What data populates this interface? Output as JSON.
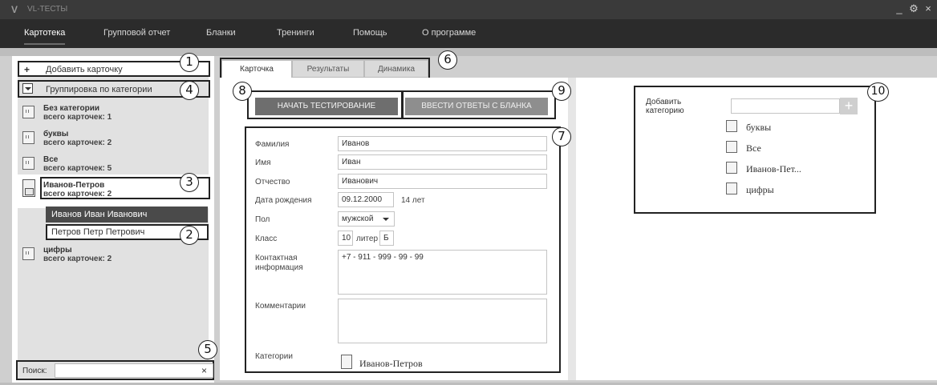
{
  "window": {
    "logo": "V",
    "title": "VL-ТЕСТЫ",
    "controls": [
      "_",
      "⚙",
      "×"
    ]
  },
  "menu": {
    "items": [
      "Картотека",
      "Групповой отчет",
      "Бланки",
      "Тренинги",
      "Помощь",
      "О программе"
    ],
    "active": "Картотека"
  },
  "sidebar": {
    "add_card": "Добавить карточку",
    "grouping": "Группировка по категории",
    "categories": [
      {
        "name": "Без категории",
        "count": "всего карточек: 1"
      },
      {
        "name": "буквы",
        "count": "всего карточек: 2"
      },
      {
        "name": "Все",
        "count": "всего карточек: 5"
      },
      {
        "name": "Иванов-Петров",
        "count": "всего карточек: 2"
      },
      {
        "name": "цифры",
        "count": "всего карточек: 2"
      }
    ],
    "persons": [
      "Иванов Иван Иванович",
      "Петров Петр Петрович"
    ],
    "search_label": "Поиск:",
    "search_value": "",
    "search_clear": "×"
  },
  "tabs": [
    "Карточка",
    "Результаты",
    "Динамика"
  ],
  "buttons": {
    "start": "НАЧАТЬ ТЕСТИРОВАНИЕ",
    "enter": "ВВЕСТИ ОТВЕТЫ С БЛАНКА"
  },
  "form": {
    "surname_label": "Фамилия",
    "surname": "Иванов",
    "name_label": "Имя",
    "name": "Иван",
    "patronymic_label": "Отчество",
    "patronymic": "Иванович",
    "birth_label": "Дата рождения",
    "birth": "09.12.2000",
    "age": "14 лет",
    "sex_label": "Пол",
    "sex": "мужской",
    "class_label": "Класс",
    "class": "10",
    "letter_label": "литер",
    "letter": "Б",
    "contact_label_1": "Контактная",
    "contact_label_2": "информация",
    "contact": "+7 - 911 - 999 - 99 - 99",
    "comments_label": "Комментарии",
    "comments": "",
    "categories_label": "Категории",
    "category": "Иванов-Петров"
  },
  "right": {
    "add_cat_1": "Добавить",
    "add_cat_2": "категорию",
    "add_plus": "+",
    "categories": [
      "буквы",
      "Все",
      "Иванов-Пет...",
      "цифры"
    ]
  },
  "callouts": [
    "1",
    "2",
    "3",
    "4",
    "5",
    "6",
    "7",
    "8",
    "9",
    "10"
  ]
}
